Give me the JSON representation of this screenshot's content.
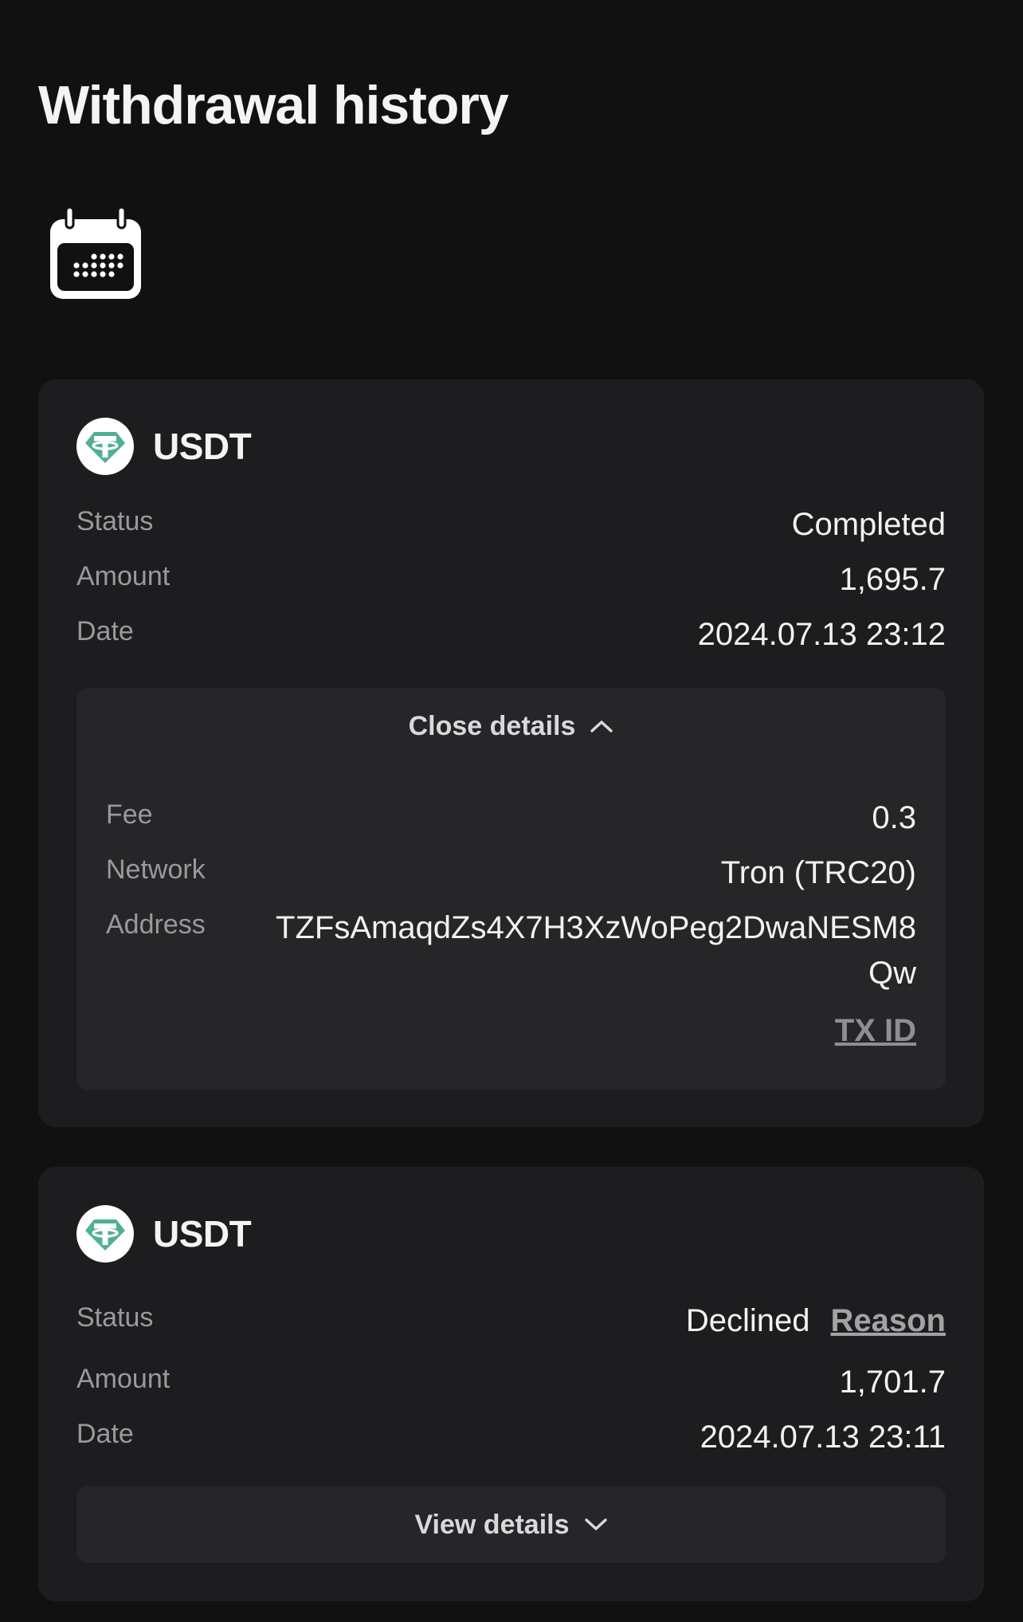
{
  "page": {
    "title": "Withdrawal history"
  },
  "calendar_icon": "calendar-icon",
  "withdrawals": [
    {
      "coin": "USDT",
      "coin_icon": "tether-icon",
      "coin_color": "#50AF95",
      "status_label": "Status",
      "status": "Completed",
      "amount_label": "Amount",
      "amount": "1,695.7",
      "date_label": "Date",
      "date": "2024.07.13 23:12",
      "details_expanded": true,
      "details_toggle_label": "Close details",
      "fee_label": "Fee",
      "fee": "0.3",
      "network_label": "Network",
      "network": "Tron (TRC20)",
      "address_label": "Address",
      "address": "TZFsAmaqdZs4X7H3XzWoPeg2DwaNESM8Qw",
      "txid_label": "TX ID"
    },
    {
      "coin": "USDT",
      "coin_icon": "tether-icon",
      "coin_color": "#50AF95",
      "status_label": "Status",
      "status": "Declined",
      "reason_label": "Reason",
      "amount_label": "Amount",
      "amount": "1,701.7",
      "date_label": "Date",
      "date": "2024.07.13 23:11",
      "details_expanded": false,
      "details_toggle_label": "View details"
    }
  ]
}
